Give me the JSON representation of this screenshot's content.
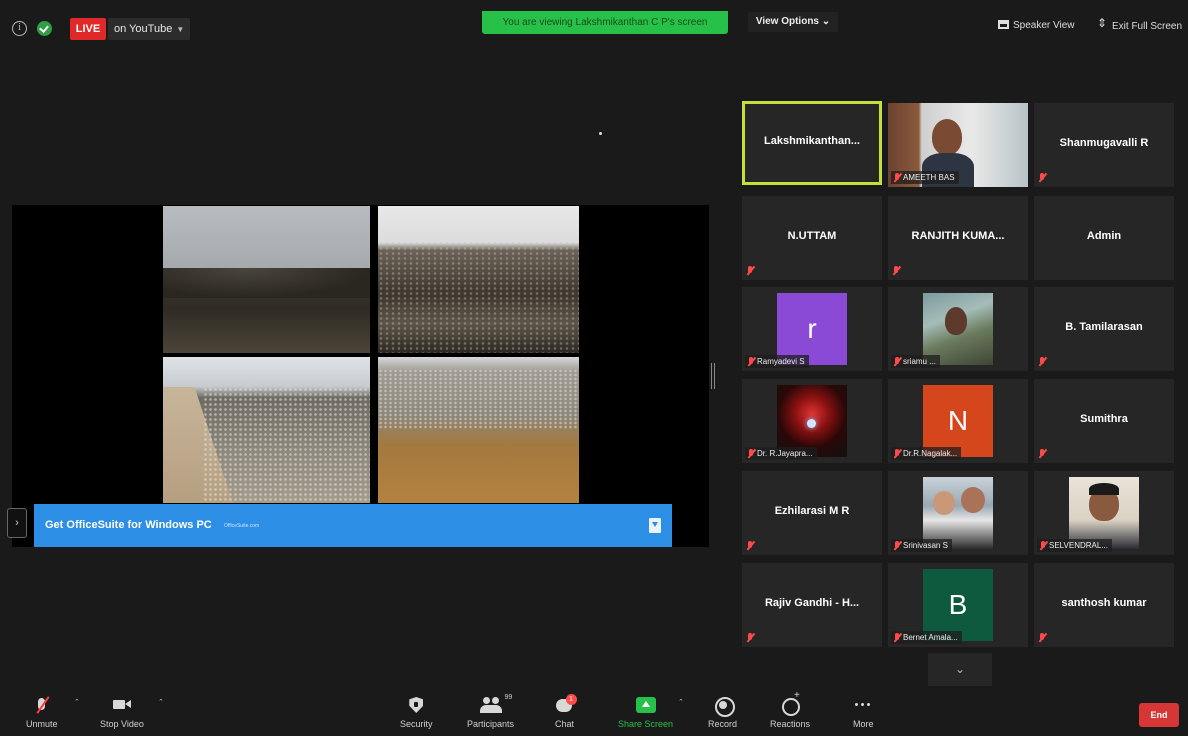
{
  "topbar": {
    "live_label": "LIVE",
    "stream_target": "on YouTube",
    "viewing_banner": "You are viewing Lakshmikanthan C P's screen",
    "view_options": "View Options",
    "speaker_view": "Speaker View",
    "exit_fullscreen": "Exit Full Screen"
  },
  "share": {
    "ad_text": "Get OfficeSuite for Windows PC",
    "ad_small": "OfficeSuite.com"
  },
  "gallery": {
    "tiles": [
      {
        "name": "Lakshmikanthan...",
        "active": true
      },
      {
        "label": "AMEETH BAS"
      },
      {
        "name": "Shanmugavalli R"
      },
      {
        "name": "N.UTTAM"
      },
      {
        "name": "RANJITH KUMA..."
      },
      {
        "name": "Admin"
      },
      {
        "avatar": "r",
        "label": "Ramyadevi S"
      },
      {
        "label": "sriamu ..."
      },
      {
        "name": "B. Tamilarasan"
      },
      {
        "label": "Dr. R.Jayapra..."
      },
      {
        "avatar": "N",
        "label": "Dr.R.Nagalak..."
      },
      {
        "name": "Sumithra"
      },
      {
        "name": "Ezhilarasi M R"
      },
      {
        "label": "Srinivasan S"
      },
      {
        "label": "SELVENDRAL..."
      },
      {
        "name": "Rajiv Gandhi - H..."
      },
      {
        "avatar": "B",
        "label": "Bernet Amala..."
      },
      {
        "name": "santhosh kumar"
      }
    ]
  },
  "toolbar": {
    "unmute": "Unmute",
    "stop_video": "Stop Video",
    "security": "Security",
    "participants": "Participants",
    "participant_count": "99",
    "chat": "Chat",
    "chat_badge": "1",
    "share_screen": "Share Screen",
    "record": "Record",
    "reactions": "Reactions",
    "more": "More",
    "end": "End"
  },
  "colors": {
    "banner_green": "#27c14a",
    "active_speaker": "#c4e03a",
    "end_red": "#d73636",
    "live_red": "#e02828",
    "ad_blue": "#2d8ee6"
  }
}
